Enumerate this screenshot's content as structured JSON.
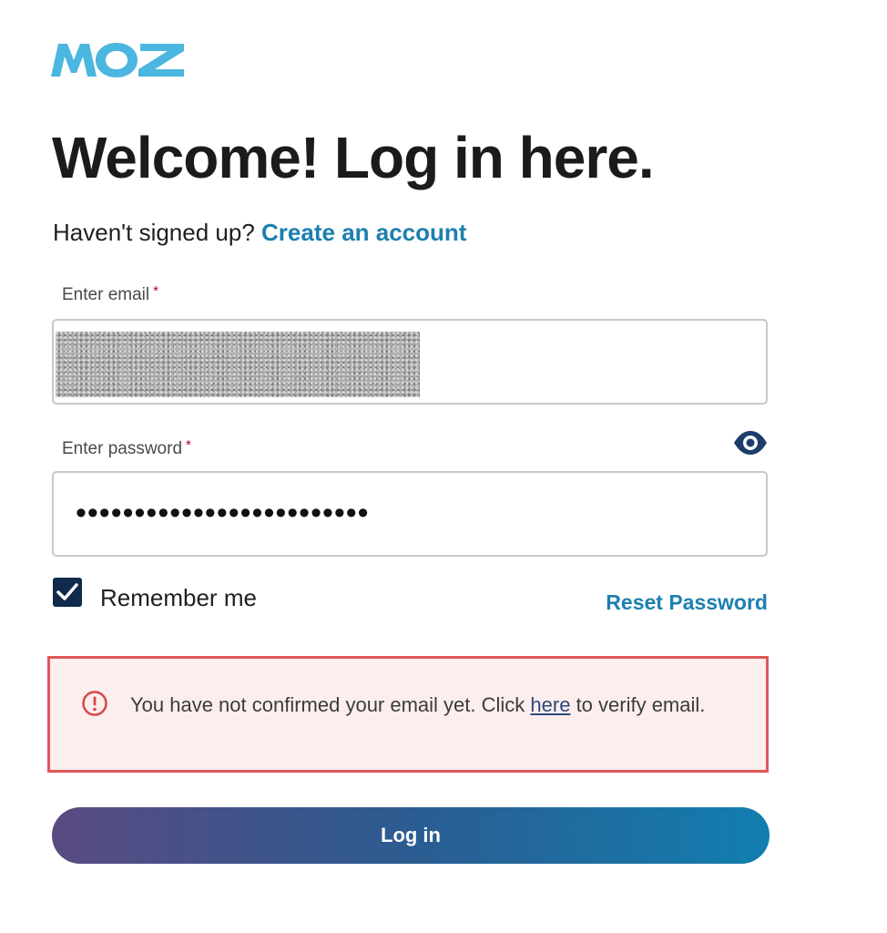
{
  "brand": {
    "logo_text": "MOZ",
    "logo_color": "#4bb6e0"
  },
  "heading": "Welcome! Log in here.",
  "signup": {
    "prompt": "Haven't signed up?",
    "link_label": "Create an account"
  },
  "email": {
    "label": "Enter email",
    "required_marker": "*",
    "value_redacted": true
  },
  "password": {
    "label": "Enter password",
    "required_marker": "*",
    "masked_value": "•••••••••••••••••••••••••",
    "toggle_icon": "eye-icon"
  },
  "remember": {
    "label": "Remember me",
    "checked": true
  },
  "reset_link": "Reset Password",
  "alert": {
    "icon": "exclamation-circle-icon",
    "text_before": "You have not confirmed your email yet. Click ",
    "link_label": "here",
    "text_after": " to verify email.",
    "border_color": "#e0575a",
    "background": "#fdeeee"
  },
  "login_button": "Log in",
  "colors": {
    "link": "#1c7fb0",
    "checkbox": "#102a4c",
    "button_gradient_start": "#5a4a82",
    "button_gradient_end": "#127eb0"
  }
}
